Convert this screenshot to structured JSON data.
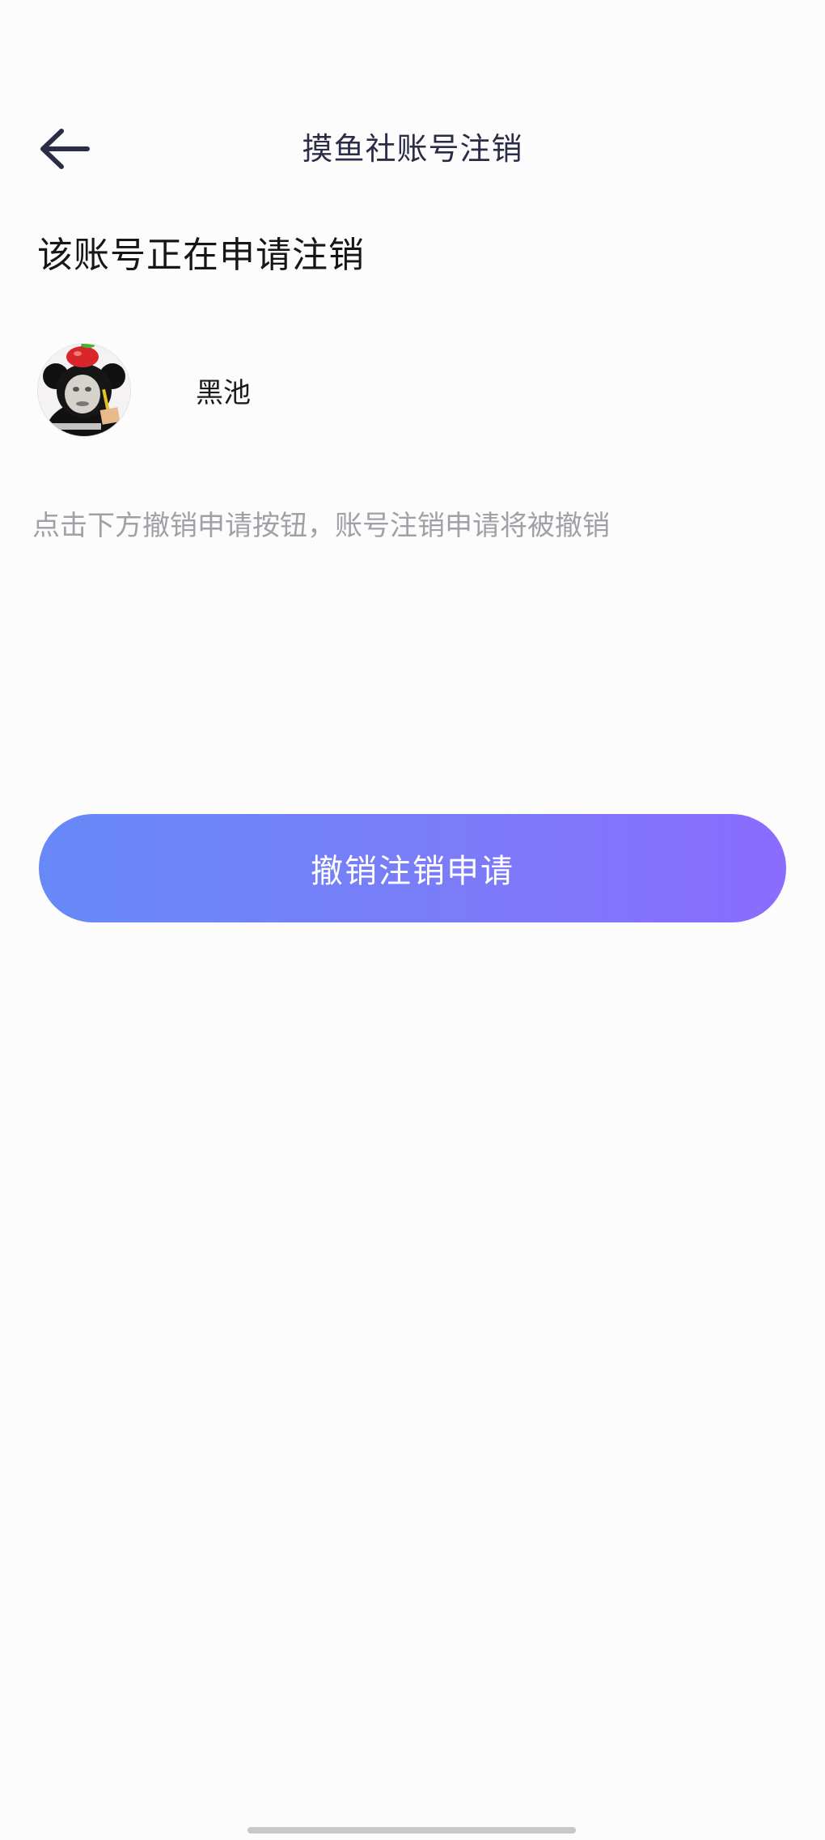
{
  "nav": {
    "title": "摸鱼社账号注销",
    "back_icon": "arrow-left-icon"
  },
  "heading": "该账号正在申请注销",
  "user": {
    "name": "黑池",
    "avatar_icon": "avatar-image"
  },
  "hint": "点击下方撤销申请按钮，账号注销申请将被撤销",
  "revoke_button": {
    "label": "撤销注销申请"
  },
  "colors": {
    "button_gradient_start": "#6789f8",
    "button_gradient_end": "#8a6cfe",
    "title_color": "#2b2c45",
    "hint_color": "#a0a0a6"
  }
}
